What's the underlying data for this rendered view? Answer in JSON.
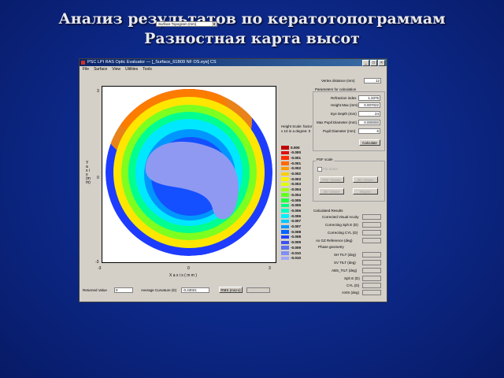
{
  "slide": {
    "title": "Анализ результатов по кератотопограммам",
    "subtitle": "Разностная карта высот"
  },
  "window": {
    "title": "PSC LPI RAS Optic Evaluator — [_Surface_61B09 NF OS.eye] CS",
    "menu": [
      "File",
      "Surface",
      "View",
      "Utilities",
      "Tools"
    ],
    "map_select": "Surface Topogram (mm)"
  },
  "plot": {
    "y_axis_label": "Y a x i s (mm)",
    "x_axis_label": "X  a x i s  ( m m )",
    "x_ticks": [
      "-3",
      "0",
      "3"
    ],
    "y_ticks": [
      "3",
      "0",
      "-3"
    ]
  },
  "legend": {
    "title": "Height Scale: factor x 10 in a degree: 0",
    "values": [
      "0.000",
      "-0.000",
      "-0.001",
      "-0.001",
      "-0.002",
      "-0.002",
      "-0.003",
      "-0.003",
      "-0.004",
      "-0.004",
      "-0.005",
      "-0.005",
      "-0.006",
      "-0.006",
      "-0.007",
      "-0.007",
      "-0.008",
      "-0.008",
      "-0.009",
      "-0.009",
      "-0.010",
      "-0.010"
    ],
    "colors": [
      "#c00000",
      "#e01010",
      "#ff3000",
      "#ff6a00",
      "#ff9a00",
      "#ffcc00",
      "#ffee00",
      "#e0ff00",
      "#a0ff00",
      "#60ff20",
      "#20ff40",
      "#00ff80",
      "#00ffc0",
      "#00f0ff",
      "#00c8ff",
      "#0096ff",
      "#0064ff",
      "#2040ff",
      "#3a50f0",
      "#5a70f0",
      "#7f8ff5",
      "#a0a8f8"
    ]
  },
  "params": {
    "vertex_distance_label": "Vertex distance (mm)",
    "vertex_distance_value": "12",
    "group_label": "Parameters for calculation",
    "rows": [
      {
        "label": "Refraction  index",
        "value": "1.3375"
      },
      {
        "label": "Height Max (mm)",
        "value": "0.007022"
      },
      {
        "label": "Eye Depth (mm)",
        "value": "24"
      },
      {
        "label": "Max Pupil Diameter (mm)",
        "value": "0.000000"
      },
      {
        "label": "Pupil Diameter (mm)",
        "value": "6"
      }
    ],
    "calculate": "Calculate"
  },
  "psf": {
    "group_label": "PSF scale",
    "checkbox": "Fix Zoom",
    "buttons": [
      "PSF Viewer",
      "3D Viewer",
      "2D Viewer",
      "Wigner"
    ]
  },
  "results": {
    "group_label": "Calculated Results",
    "rows": [
      "Corrected Visual Acuity",
      "Correcting Sph E (D)",
      "Correcting CYL (D)",
      "Ax GZ Reference (deg)"
    ],
    "phase_label": "Phase geometry",
    "phase_rows": [
      "SH TILT (deg)",
      "SV TILT (deg)",
      "ABS_TILT (deg)",
      "Sph E (D)",
      "CYL (D)",
      "AXIS (deg)"
    ]
  },
  "status": {
    "returned_value_label": "Returned Value",
    "returned_value": "0",
    "avg_curv_label": "Average Curvature (D)",
    "avg_curv_value": "-0.43021",
    "rms_button": "RMS (micro)"
  }
}
